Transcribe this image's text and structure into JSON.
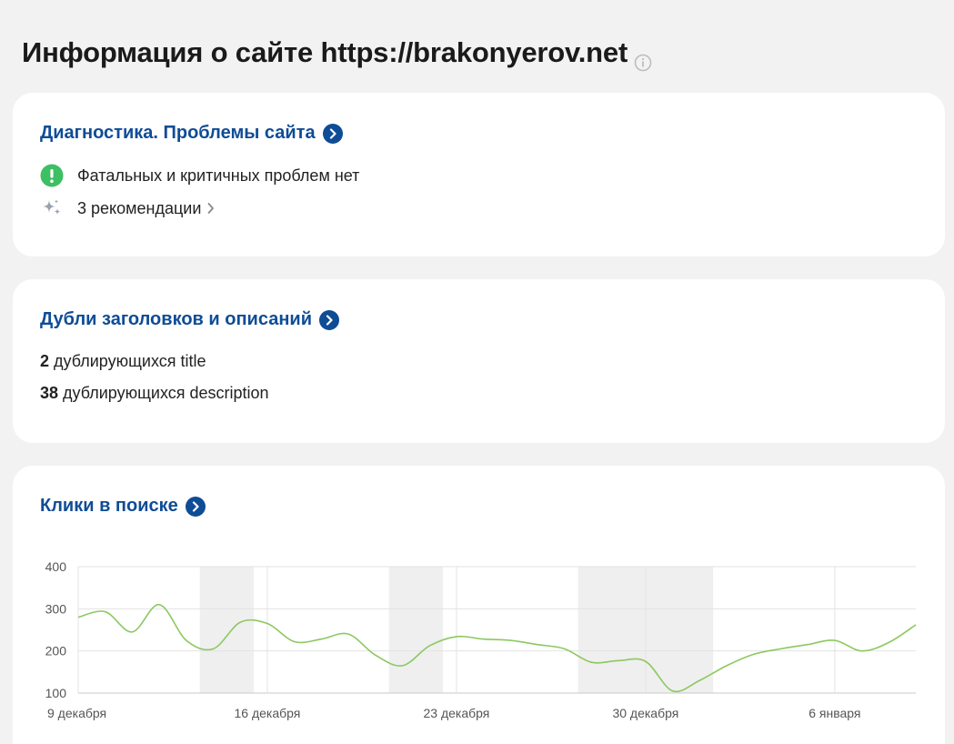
{
  "page": {
    "title": "Информация о сайте https://brakonyerov.net",
    "info_icon": "info-circle-icon"
  },
  "diagnostics": {
    "title": "Диагностика. Проблемы сайта",
    "status_text": "Фатальных и критичных проблем нет",
    "status_color": "#3dbf63",
    "recommendations_label": "3 рекомендации"
  },
  "duplicates": {
    "title": "Дубли заголовков и описаний",
    "title_count": "2",
    "title_label": "дублирующихся title",
    "desc_count": "38",
    "desc_label": "дублирующихся description"
  },
  "clicks": {
    "title": "Клики в поиске"
  },
  "colors": {
    "accent": "#0f4c96",
    "line": "#8cc860",
    "shade": "#efefef"
  },
  "chart_data": {
    "type": "line",
    "title": "",
    "xlabel": "",
    "ylabel": "",
    "ylim": [
      100,
      400
    ],
    "yticks": [
      400,
      300,
      200,
      100
    ],
    "x_tick_labels": [
      "9 декабря",
      "16 декабря",
      "23 декабря",
      "30 декабря",
      "6 января"
    ],
    "x_tick_days": [
      0,
      7,
      14,
      21,
      28
    ],
    "x_range_days": [
      0,
      31
    ],
    "weekend_shading_days": [
      [
        4.5,
        6.5
      ],
      [
        11.5,
        13.5
      ],
      [
        18.5,
        23.5
      ]
    ],
    "series": [
      {
        "days": [
          0,
          1,
          2,
          3,
          4,
          5,
          6,
          7,
          8,
          9,
          10,
          11,
          12,
          13,
          14,
          15,
          16,
          17,
          18,
          19,
          20,
          21,
          22,
          23,
          24,
          25,
          26,
          27,
          28,
          29,
          30,
          31
        ],
        "values": [
          280,
          293,
          245,
          310,
          225,
          205,
          268,
          265,
          222,
          228,
          240,
          190,
          165,
          212,
          234,
          228,
          225,
          215,
          205,
          173,
          177,
          175,
          105,
          130,
          165,
          192,
          205,
          215,
          225,
          200,
          220,
          262
        ]
      }
    ]
  }
}
